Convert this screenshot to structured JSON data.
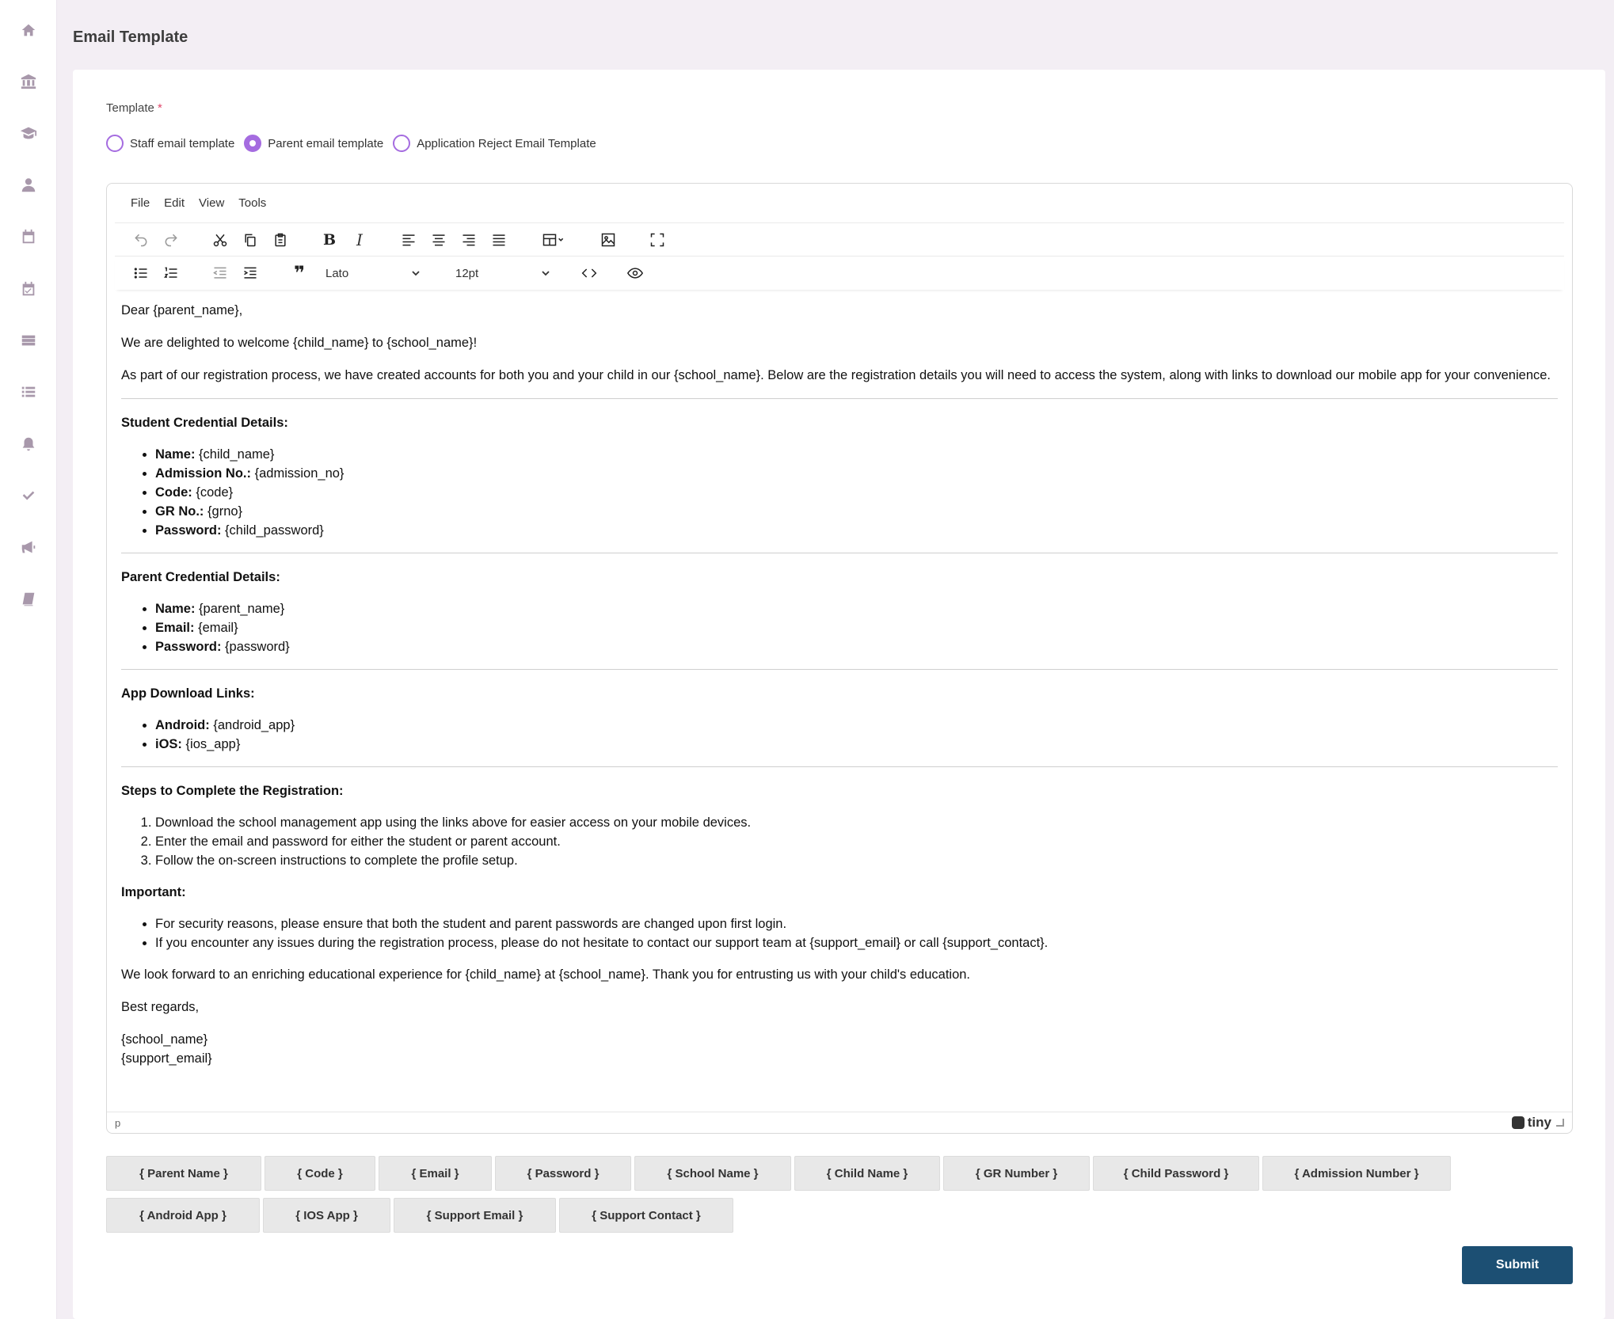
{
  "page": {
    "title": "Email Template"
  },
  "form": {
    "template_label": "Template",
    "required_mark": "*",
    "radios": [
      {
        "label": "Staff email template",
        "checked": false
      },
      {
        "label": "Parent email template",
        "checked": true
      },
      {
        "label": "Application Reject Email Template",
        "checked": false
      }
    ],
    "submit_label": "Submit"
  },
  "editor": {
    "menu": [
      "File",
      "Edit",
      "View",
      "Tools"
    ],
    "font_family": "Lato",
    "font_size": "12pt",
    "path": "p",
    "brand": "tiny",
    "content": {
      "greeting": "Dear {parent_name},",
      "welcome": "We are delighted to welcome {child_name} to {school_name}!",
      "intro": "As part of our registration process, we have created accounts for both you and your child in our {school_name}. Below are the registration details you will need to access the system, along with links to download our mobile app for your convenience.",
      "student_heading": "Student Credential Details:",
      "student_items": [
        {
          "label": "Name:",
          "value": "{child_name}"
        },
        {
          "label": "Admission No.:",
          "value": "{admission_no}"
        },
        {
          "label": "Code:",
          "value": "{code}"
        },
        {
          "label": "GR No.:",
          "value": "{grno}"
        },
        {
          "label": "Password:",
          "value": "{child_password}"
        }
      ],
      "parent_heading": "Parent Credential Details:",
      "parent_items": [
        {
          "label": "Name:",
          "value": "{parent_name}"
        },
        {
          "label": "Email:",
          "value": "{email}"
        },
        {
          "label": "Password:",
          "value": "{password}"
        }
      ],
      "app_heading": "App Download Links:",
      "app_items": [
        {
          "label": "Android:",
          "value": "{android_app}"
        },
        {
          "label": "iOS:",
          "value": "{ios_app}"
        }
      ],
      "steps_heading": "Steps to Complete the Registration:",
      "steps": [
        "Download the school management app using the links above for easier access on your mobile devices.",
        "Enter the email and password for either the student or parent account.",
        "Follow the on-screen instructions to complete the profile setup."
      ],
      "important_heading": "Important:",
      "important_items": [
        "For security reasons, please ensure that both the student and parent passwords are changed upon first login.",
        "If you encounter any issues during the registration process, please do not hesitate to contact our support team at {support_email} or call {support_contact}."
      ],
      "closing": "We look forward to an enriching educational experience for {child_name} at {school_name}. Thank you for entrusting us with your child's education.",
      "regards": "Best regards,",
      "sign_school": "{school_name}",
      "sign_email": "{support_email}"
    }
  },
  "placeholders_row1": [
    "{ Parent Name }",
    "{ Code }",
    "{ Email }",
    "{ Password }",
    "{ School Name }",
    "{ Child Name }",
    "{ GR Number }",
    "{ Child Password }",
    "{ Admission Number }"
  ],
  "placeholders_row2": [
    "{ Android App }",
    "{ IOS App }",
    "{ Support Email }",
    "{ Support Contact }"
  ],
  "sidebar_icons": [
    "home-icon",
    "institution-icon",
    "graduation-cap-icon",
    "user-icon",
    "calendar-icon",
    "calendar-check-icon",
    "id-card-icon",
    "list-icon",
    "bell-icon",
    "check-icon",
    "bullhorn-icon",
    "book-icon"
  ],
  "colors": {
    "accent": "#a56ce0",
    "submit": "#1c4f73",
    "background": "#f3eef4"
  }
}
